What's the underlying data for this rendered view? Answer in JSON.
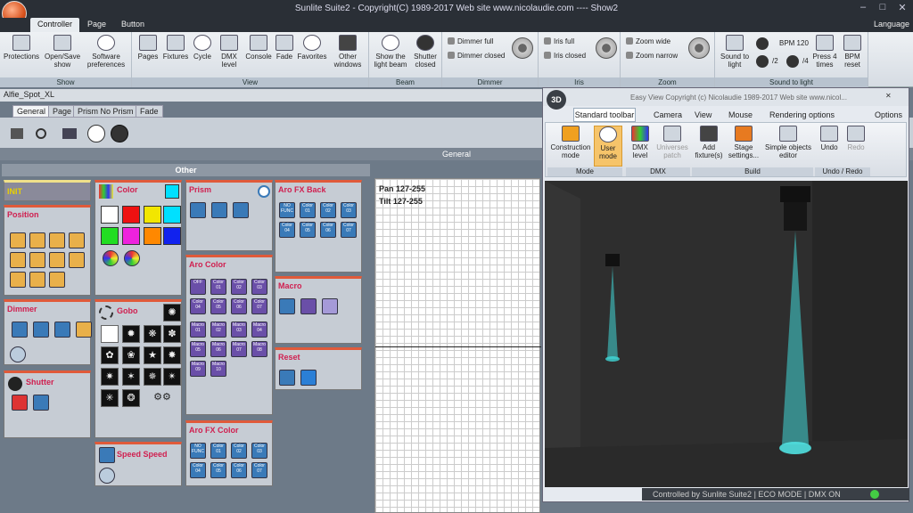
{
  "window": {
    "title": "Sunlite Suite2 - Copyright(C) 1989-2017   Web site www.nicolaudie.com ---- Show2",
    "language": "Language"
  },
  "menu_tabs": [
    "Controller",
    "Page",
    "Button"
  ],
  "ribbon": {
    "show": {
      "label": "Show",
      "items": [
        "Protections",
        "Open/Save show",
        "Software preferences"
      ]
    },
    "view": {
      "label": "View",
      "items": [
        "Pages",
        "Fixtures",
        "Cycle",
        "DMX level",
        "Console",
        "Fade",
        "Favorites",
        "Other windows"
      ]
    },
    "beam": {
      "label": "Beam",
      "items": [
        "Show the light beam",
        "Shutter closed"
      ]
    },
    "dimmer": {
      "label": "Dimmer",
      "items": [
        "Dimmer full",
        "Dimmer closed"
      ]
    },
    "iris": {
      "label": "Iris",
      "items": [
        "Iris full",
        "Iris closed"
      ]
    },
    "zoom": {
      "label": "Zoom",
      "items": [
        "Zoom wide",
        "Zoom narrow"
      ]
    },
    "sound": {
      "label": "Sound to light",
      "items": [
        "Sound to light",
        "BPM 120",
        "/2",
        "/4",
        "Press 4 times",
        "BPM reset"
      ]
    }
  },
  "device": {
    "name": "Alfie_Spot_XL",
    "tabs": [
      "General",
      "Page",
      "Prism No Prism",
      "Fade"
    ],
    "general_label": "General"
  },
  "other": {
    "title": "Other"
  },
  "panels": {
    "init": "INIT",
    "position": "Position",
    "color": "Color",
    "prism": "Prism",
    "aro_fx_back": "Aro FX Back",
    "aro_color": "Aro Color",
    "macro": "Macro",
    "dimmer": "Dimmer",
    "gobo": "Gobo",
    "reset": "Reset",
    "shutter": "Shutter",
    "aro_fx_color": "Aro FX Color",
    "speed": "Speed Speed"
  },
  "color_swatches": [
    "#ffffff",
    "#ee1111",
    "#f2e600",
    "#00e0ff",
    "#22dd22",
    "#ee22dd",
    "#ff8800",
    "#1122ee"
  ],
  "aro_buttons": [
    "OFF",
    "Color 01",
    "Color 02",
    "Color 03",
    "Color 04",
    "Color 05",
    "Color 06",
    "Color 07"
  ],
  "macro_buttons": [
    "Macro 01",
    "Macro 02",
    "Macro 03",
    "Macro 04",
    "Macro 05",
    "Macro 06",
    "Macro 07",
    "Macro 08",
    "Macro 09",
    "Macro 10"
  ],
  "fx_back_buttons": [
    "NO FUNC",
    "Color 01",
    "Color 02",
    "Color 03",
    "Color 04",
    "Color 05",
    "Color 06",
    "Color 07"
  ],
  "fx_color_buttons": [
    "NO FUNC",
    "Color 01",
    "Color 02",
    "Color 03",
    "Color 04",
    "Color 05",
    "Color 06",
    "Color 07"
  ],
  "pan_tilt": {
    "pan": "Pan 127-255",
    "tilt": "Tilt 127-255"
  },
  "easy_view": {
    "title": "Easy View   Copyright (c) Nicolaudie 1989-2017   Web site www.nicol...",
    "tabs": [
      "Standard toolbar",
      "Camera",
      "View",
      "Mouse",
      "Rendering options"
    ],
    "options": "Options",
    "mode_group": "Mode",
    "dmx_group": "DMX",
    "build_group": "Build",
    "undo_group": "Undo / Redo",
    "buttons": [
      "Construction mode",
      "User mode",
      "DMX level",
      "Universes patch",
      "Add fixture(s)",
      "Stage settings...",
      "Simple objects editor",
      "Undo",
      "Redo"
    ]
  },
  "status": "Controlled by Sunlite Suite2  |  ECO MODE  |  DMX ON"
}
